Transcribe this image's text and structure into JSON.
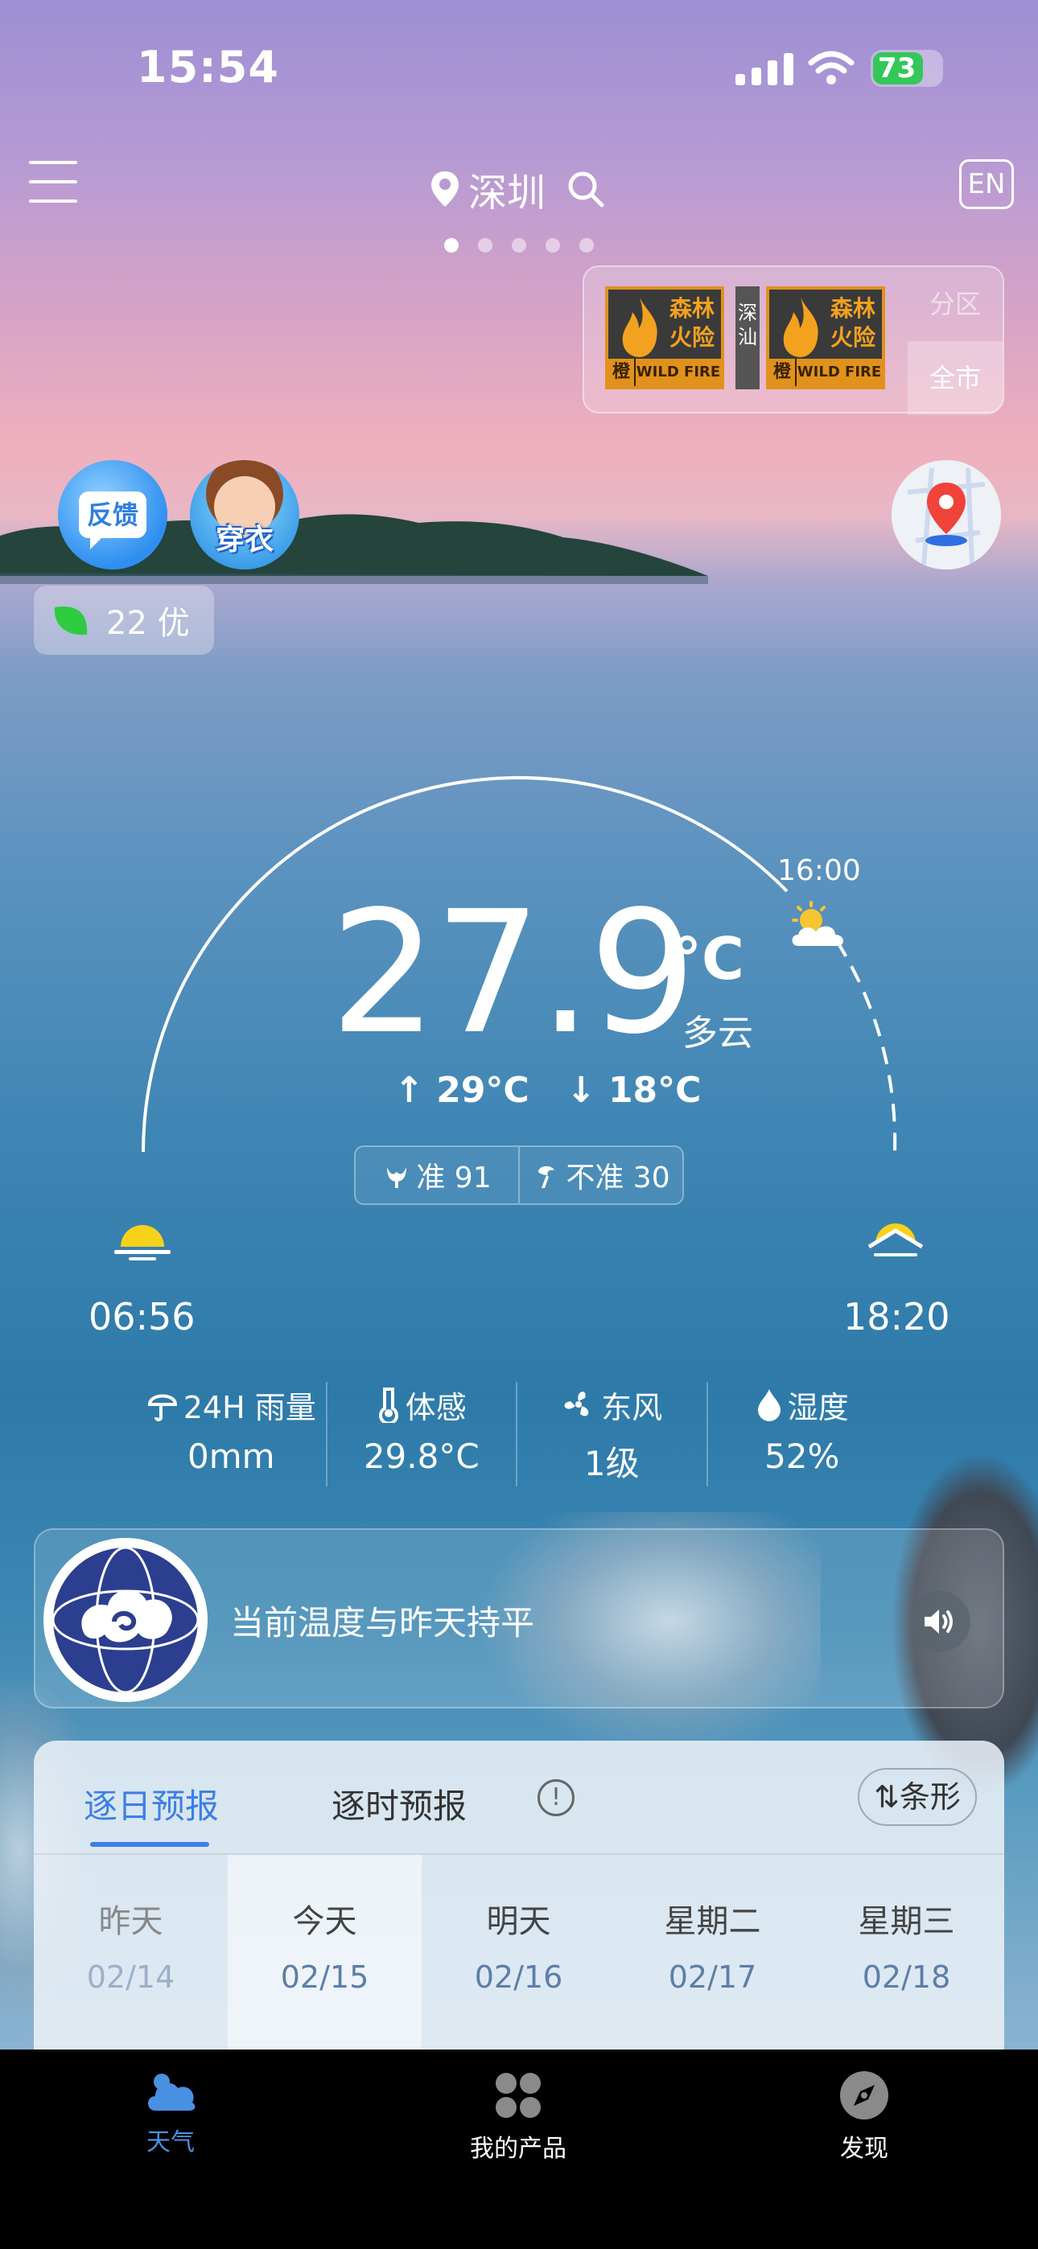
{
  "status_bar": {
    "time": "15:54",
    "battery": "73"
  },
  "header": {
    "city": "深圳",
    "lang_button": "EN",
    "page_count": 5,
    "active_page": 1
  },
  "warnings": {
    "badges": [
      {
        "title_line1": "森林",
        "title_line2": "火险",
        "level": "橙",
        "footer": "WILD FIRE"
      },
      {
        "title_line1": "森林",
        "title_line2": "火险",
        "level": "橙",
        "footer": "WILD FIRE"
      }
    ],
    "region_label": "深汕",
    "segments": [
      {
        "label": "分区",
        "active": false
      },
      {
        "label": "全市",
        "active": true
      }
    ]
  },
  "quick_buttons": {
    "feedback": "反馈",
    "clothing": "穿衣"
  },
  "aqi": {
    "value": "22",
    "level": "优",
    "color": "#2ecc40"
  },
  "current": {
    "temperature": "27.9",
    "unit": "°C",
    "condition": "多云",
    "high": "29°C",
    "low": "18°C",
    "next_hour": "16:00",
    "accurate_label": "准 91",
    "inaccurate_label": "不准 30"
  },
  "sun": {
    "sunrise": "06:56",
    "sunset": "18:20"
  },
  "stats": [
    {
      "label": "24H 雨量",
      "value": "0mm",
      "icon": "umbrella-icon"
    },
    {
      "label": "体感",
      "value": "29.8°C",
      "icon": "thermometer-icon"
    },
    {
      "label": "东风",
      "value": "1级",
      "icon": "fan-icon"
    },
    {
      "label": "湿度",
      "value": "52%",
      "icon": "droplet-icon"
    }
  ],
  "broadcast": {
    "text": "当前温度与昨天持平"
  },
  "forecast": {
    "tab_daily": "逐日预报",
    "tab_hourly": "逐时预报",
    "view_toggle": "条形",
    "days": [
      {
        "name": "昨天",
        "date": "02/14"
      },
      {
        "name": "今天",
        "date": "02/15"
      },
      {
        "name": "明天",
        "date": "02/16"
      },
      {
        "name": "星期二",
        "date": "02/17"
      },
      {
        "name": "星期三",
        "date": "02/18"
      }
    ]
  },
  "nav": {
    "weather": "天气",
    "products": "我的产品",
    "discover": "发现"
  },
  "colors": {
    "accent": "#3e7ee6",
    "nav_active": "#4a90e2",
    "warning_orange": "#e0921c"
  }
}
